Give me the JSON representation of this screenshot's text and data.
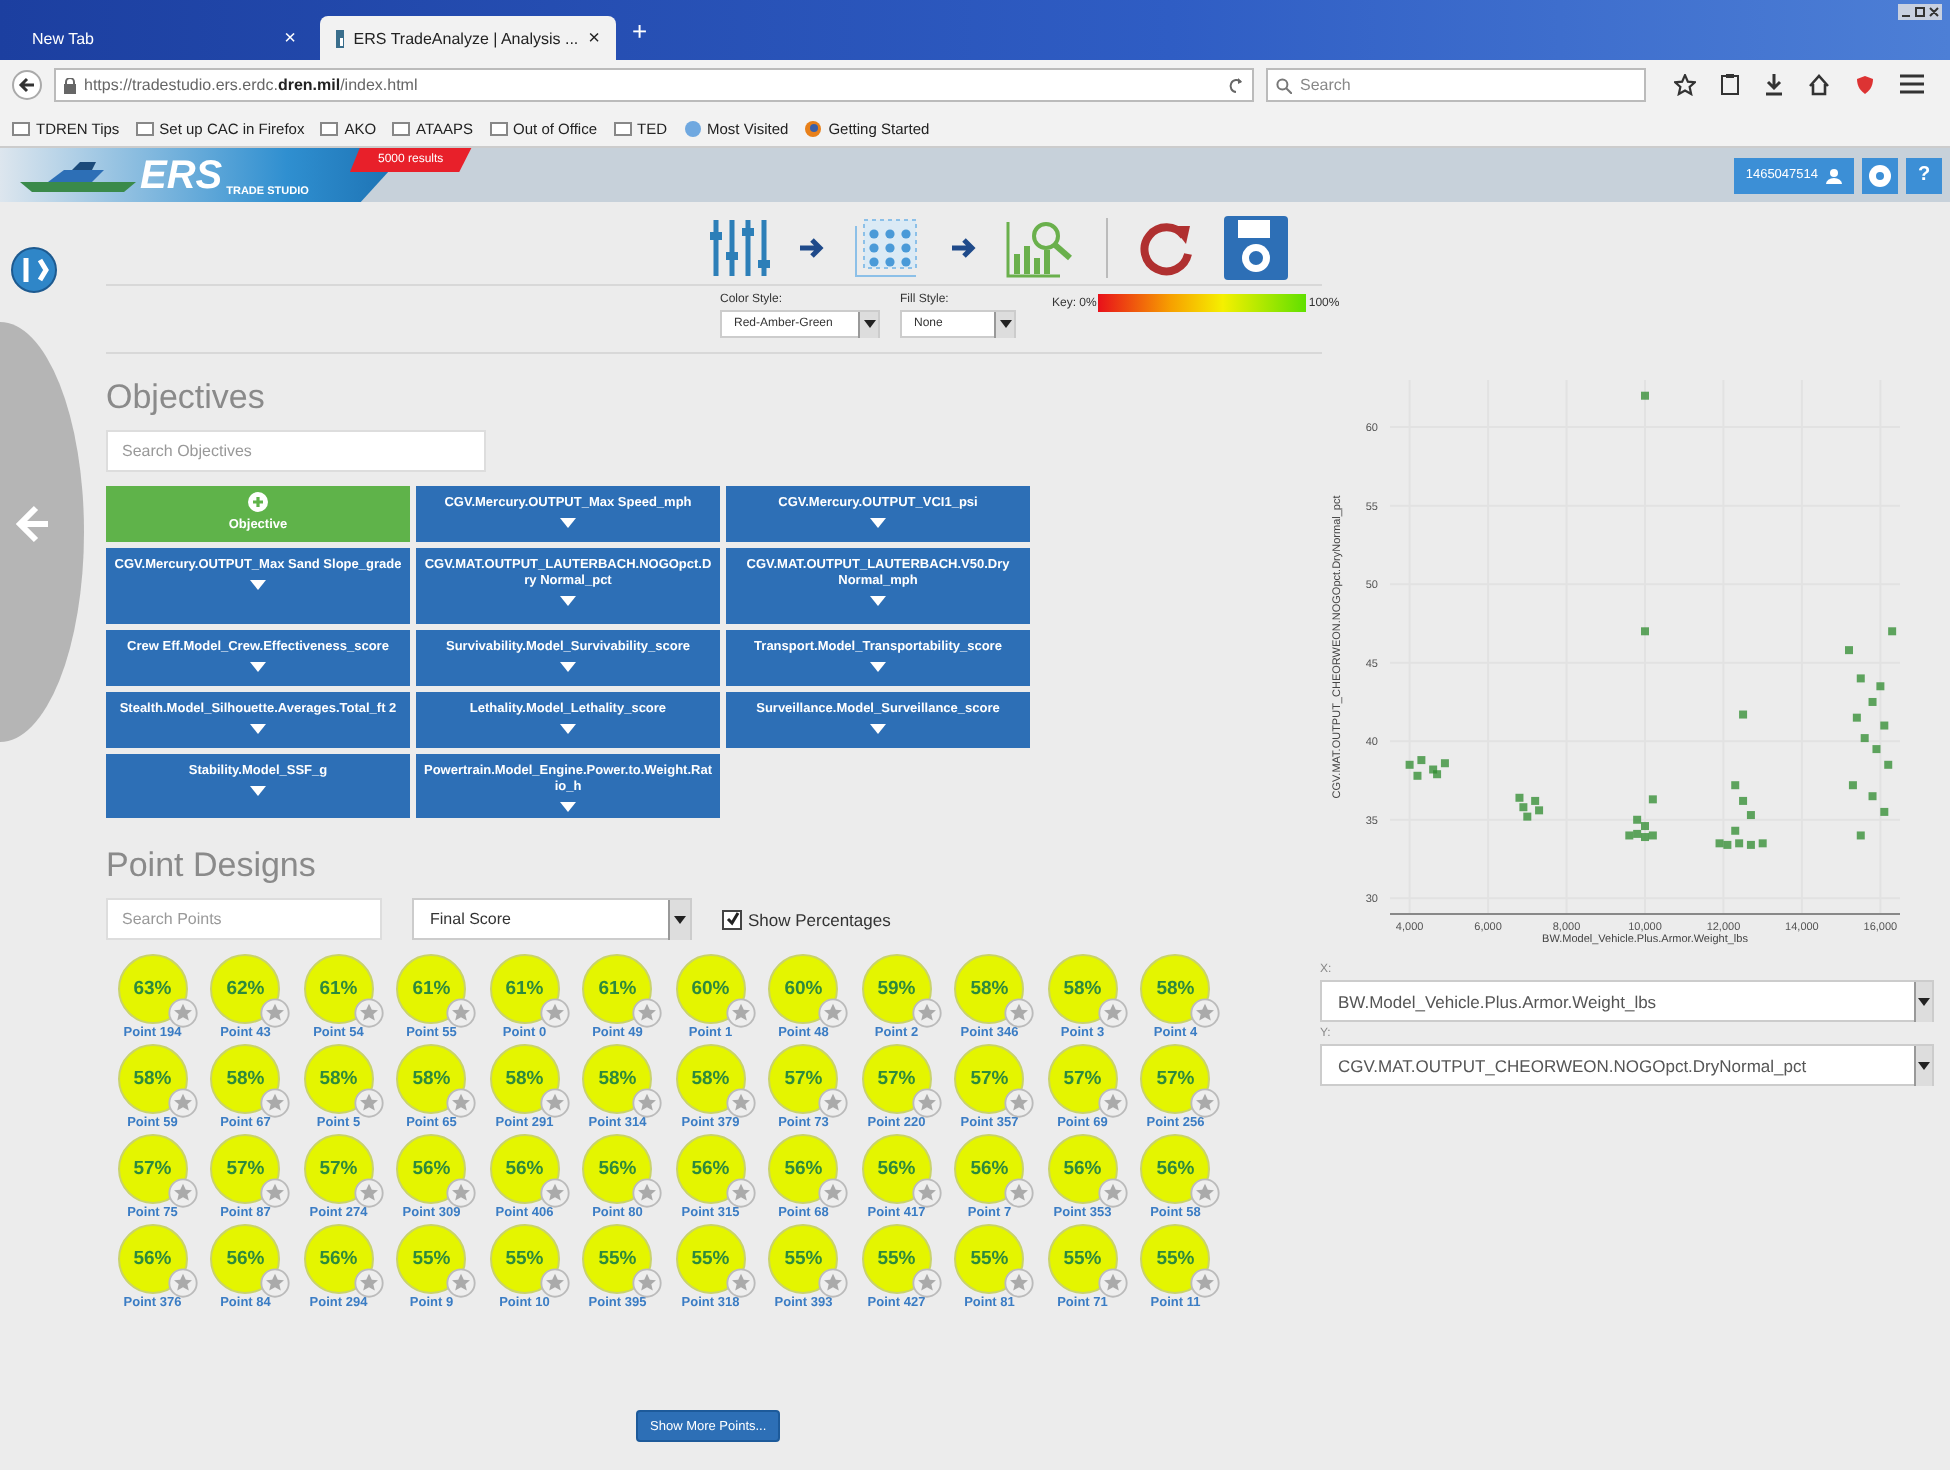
{
  "browser": {
    "tabs": [
      {
        "label": "New Tab",
        "selected": false
      },
      {
        "label": "ERS TradeAnalyze | Analysis ...",
        "selected": true
      }
    ],
    "new_tab": "+",
    "close": "×",
    "url": "https://tradestudio.ers.erdc.**dren.mil**/index.html",
    "search": {
      "placeholder": "Search"
    },
    "bookmarks": [
      {
        "label": "TDREN Tips",
        "kind": "folder"
      },
      {
        "label": "Set up CAC in Firefox",
        "kind": "folder"
      },
      {
        "label": "AKO",
        "kind": "folder"
      },
      {
        "label": "ATAAPS",
        "kind": "folder"
      },
      {
        "label": "Out of Office",
        "kind": "folder"
      },
      {
        "label": "TED",
        "kind": "folder"
      },
      {
        "label": "Most Visited",
        "kind": "globe"
      },
      {
        "label": "Getting Started",
        "kind": "firefox"
      }
    ]
  },
  "header": {
    "logo": "ERS",
    "logo_sub": "TRADE STUDIO",
    "results": "5000 results",
    "user": "1465047514",
    "help": "?"
  },
  "display": {
    "color_style_label": "Color Style:",
    "color_style": "Red-Amber-Green",
    "fill_style_label": "Fill Style:",
    "fill_style": "None",
    "key_label": "Key: 0%",
    "key_max": "100%"
  },
  "objectives": {
    "title": "Objectives",
    "search": {
      "placeholder": "Search Objectives"
    },
    "add_button": "Objective",
    "tiles": [
      {
        "kind": "objective",
        "label": "CGV.Mercury.OUTPUT_Max Speed_mph"
      },
      {
        "kind": "objective",
        "label": "CGV.Mercury.OUTPUT_VCI1_psi"
      },
      {
        "kind": "objective",
        "label": "CGV.Mercury.OUTPUT_Max Sand Slope_grade"
      },
      {
        "kind": "objective",
        "label": "CGV.MAT.OUTPUT_LAUTERBACH.NOGOpct.Dry Normal_pct"
      },
      {
        "kind": "objective",
        "label": "CGV.MAT.OUTPUT_LAUTERBACH.V50.Dry Normal_mph"
      },
      {
        "kind": "objective",
        "label": "Crew Eff.Model_Crew.Effectiveness_score"
      },
      {
        "kind": "objective",
        "label": "Survivability.Model_Survivability_score"
      },
      {
        "kind": "objective",
        "label": "Transport.Model_Transportability_score"
      },
      {
        "kind": "objective",
        "label": "Stealth.Model_Silhouette.Averages.Total_ft 2"
      },
      {
        "kind": "objective",
        "label": "Lethality.Model_Lethality_score"
      },
      {
        "kind": "objective",
        "label": "Surveillance.Model_Surveillance_score"
      },
      {
        "kind": "objective",
        "label": "Stability.Model_SSF_g"
      },
      {
        "kind": "objective",
        "label": "Powertrain.Model_Engine.Power.to.Weight.Ratio_h"
      }
    ]
  },
  "points": {
    "title": "Point Designs",
    "search": {
      "placeholder": "Search Points"
    },
    "sort": "Final Score",
    "show_percentages": {
      "label": "Show Percentages",
      "checked": true
    },
    "items": [
      {
        "score": "63%",
        "name": "Point 194"
      },
      {
        "score": "62%",
        "name": "Point 43"
      },
      {
        "score": "61%",
        "name": "Point 54"
      },
      {
        "score": "61%",
        "name": "Point 55"
      },
      {
        "score": "61%",
        "name": "Point 0"
      },
      {
        "score": "61%",
        "name": "Point 49"
      },
      {
        "score": "60%",
        "name": "Point 1"
      },
      {
        "score": "60%",
        "name": "Point 48"
      },
      {
        "score": "59%",
        "name": "Point 2"
      },
      {
        "score": "58%",
        "name": "Point 346"
      },
      {
        "score": "58%",
        "name": "Point 3"
      },
      {
        "score": "58%",
        "name": "Point 4"
      },
      {
        "score": "58%",
        "name": "Point 59"
      },
      {
        "score": "58%",
        "name": "Point 67"
      },
      {
        "score": "58%",
        "name": "Point 5"
      },
      {
        "score": "58%",
        "name": "Point 65"
      },
      {
        "score": "58%",
        "name": "Point 291"
      },
      {
        "score": "58%",
        "name": "Point 314"
      },
      {
        "score": "58%",
        "name": "Point 379"
      },
      {
        "score": "57%",
        "name": "Point 73"
      },
      {
        "score": "57%",
        "name": "Point 220"
      },
      {
        "score": "57%",
        "name": "Point 357"
      },
      {
        "score": "57%",
        "name": "Point 69"
      },
      {
        "score": "57%",
        "name": "Point 256"
      },
      {
        "score": "57%",
        "name": "Point 75"
      },
      {
        "score": "57%",
        "name": "Point 87"
      },
      {
        "score": "57%",
        "name": "Point 274"
      },
      {
        "score": "56%",
        "name": "Point 309"
      },
      {
        "score": "56%",
        "name": "Point 406"
      },
      {
        "score": "56%",
        "name": "Point 80"
      },
      {
        "score": "56%",
        "name": "Point 315"
      },
      {
        "score": "56%",
        "name": "Point 68"
      },
      {
        "score": "56%",
        "name": "Point 417"
      },
      {
        "score": "56%",
        "name": "Point 7"
      },
      {
        "score": "56%",
        "name": "Point 353"
      },
      {
        "score": "56%",
        "name": "Point 58"
      },
      {
        "score": "56%",
        "name": "Point 376"
      },
      {
        "score": "56%",
        "name": "Point 84"
      },
      {
        "score": "56%",
        "name": "Point 294"
      },
      {
        "score": "55%",
        "name": "Point 9"
      },
      {
        "score": "55%",
        "name": "Point 10"
      },
      {
        "score": "55%",
        "name": "Point 395"
      },
      {
        "score": "55%",
        "name": "Point 318"
      },
      {
        "score": "55%",
        "name": "Point 393"
      },
      {
        "score": "55%",
        "name": "Point 427"
      },
      {
        "score": "55%",
        "name": "Point 81"
      },
      {
        "score": "55%",
        "name": "Point 71"
      },
      {
        "score": "55%",
        "name": "Point 11"
      }
    ],
    "more": "Show More Points..."
  },
  "plot": {
    "chart_data": {
      "type": "scatter",
      "xlabel": "BW.Model_Vehicle.Plus.Armor.Weight_lbs",
      "ylabel": "CGV.MAT.OUTPUT_CHEORWEON.NOGOpct.DryNormal_pct",
      "grid": true,
      "xlim": [
        3500,
        16500
      ],
      "ylim": [
        29,
        63
      ],
      "xticks": [
        {
          "value": 4000,
          "label": "4,000"
        },
        {
          "value": 6000,
          "label": "6,000"
        },
        {
          "value": 8000,
          "label": "8,000"
        },
        {
          "value": 10000,
          "label": "10,000"
        },
        {
          "value": 12000,
          "label": "12,000"
        },
        {
          "value": 14000,
          "label": "14,000"
        },
        {
          "value": 16000,
          "label": "16,000"
        }
      ],
      "yticks": [
        30,
        35,
        40,
        45,
        50,
        55,
        60
      ],
      "x": [
        4000,
        4300,
        4600,
        4900,
        4200,
        4700,
        6800,
        7200,
        6900,
        7300,
        7000,
        9600,
        9800,
        10000,
        10200,
        10000,
        10200,
        9800,
        10000,
        10000,
        11900,
        12100,
        12400,
        12700,
        13000,
        12300,
        12700,
        12500,
        12300,
        12500,
        15200,
        15500,
        15800,
        16100,
        15600,
        15900,
        16200,
        15300,
        15800,
        16100,
        15500,
        16300,
        16000,
        15400
      ],
      "series": [
        {
          "color": "#2e8b2e",
          "values": [
            38.5,
            38.8,
            38.2,
            38.6,
            37.8,
            37.9,
            36.4,
            36.2,
            35.8,
            35.6,
            35.2,
            34.0,
            34.1,
            33.9,
            34.0,
            34.6,
            36.3,
            35.0,
            47.0,
            62.0,
            33.5,
            33.4,
            33.5,
            33.4,
            33.5,
            34.3,
            35.3,
            36.2,
            37.2,
            41.7,
            45.8,
            44.0,
            42.5,
            41.0,
            40.2,
            39.5,
            38.5,
            37.2,
            36.5,
            35.5,
            34.0,
            47.0,
            43.5,
            41.5
          ]
        }
      ]
    },
    "x_label": "X:",
    "x_field": "BW.Model_Vehicle.Plus.Armor.Weight_lbs",
    "y_label": "Y:",
    "y_field": "CGV.MAT.OUTPUT_CHEORWEON.NOGOpct.DryNormal_pct"
  }
}
